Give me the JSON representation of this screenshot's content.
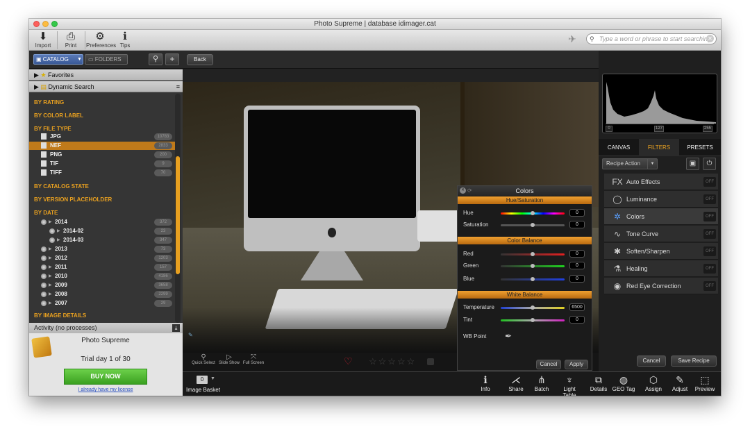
{
  "window": {
    "title": "Photo Supreme | database idimager.cat"
  },
  "toolbar": {
    "import": "Import",
    "print": "Print",
    "preferences": "Preferences",
    "tips": "Tips",
    "search_placeholder": "Type a word or phrase to start searching"
  },
  "left": {
    "catalog": "CATALOG",
    "folders": "FOLDERS",
    "favorites": "Favorites",
    "dynamic_search": "Dynamic Search",
    "sections": {
      "rating": "BY RATING",
      "color": "BY COLOR LABEL",
      "filetype": "BY FILE TYPE",
      "catalog_state": "BY CATALOG STATE",
      "version": "BY VERSION PLACEHOLDER",
      "date": "BY DATE",
      "image_details": "BY IMAGE DETAILS"
    },
    "file_types": [
      {
        "label": "JPG",
        "count": "10783"
      },
      {
        "label": "NEF",
        "count": "2833"
      },
      {
        "label": "PNG",
        "count": "200"
      },
      {
        "label": "TIF",
        "count": "9"
      },
      {
        "label": "TIFF",
        "count": "70"
      }
    ],
    "dates": [
      {
        "label": "2014",
        "count": "372"
      },
      {
        "label": "2014-02",
        "count": "23"
      },
      {
        "label": "2014-03",
        "count": "347"
      },
      {
        "label": "2013",
        "count": "73"
      },
      {
        "label": "2012",
        "count": "1203"
      },
      {
        "label": "2011",
        "count": "157"
      },
      {
        "label": "2010",
        "count": "4186"
      },
      {
        "label": "2009",
        "count": "3658"
      },
      {
        "label": "2008",
        "count": "2299"
      },
      {
        "label": "2007",
        "count": "29"
      }
    ],
    "activity": "Activity (no processes)",
    "promo": {
      "app": "Photo Supreme",
      "trial": "Trial day 1 of 30",
      "buy": "BUY NOW",
      "license": "I already have my license"
    }
  },
  "content": {
    "back": "Back",
    "quick_select": "Quick Select",
    "slide_show": "Slide Show",
    "full_screen": "Full Screen"
  },
  "dialog": {
    "title": "Colors",
    "sections": {
      "hs": "Hue/Saturation",
      "cb": "Color Balance",
      "wb": "White Balance"
    },
    "hue": {
      "label": "Hue",
      "value": "0"
    },
    "saturation": {
      "label": "Saturation",
      "value": "0"
    },
    "red": {
      "label": "Red",
      "value": "0"
    },
    "green": {
      "label": "Green",
      "value": "0"
    },
    "blue": {
      "label": "Blue",
      "value": "0"
    },
    "temperature": {
      "label": "Temperature",
      "value": "6500"
    },
    "tint": {
      "label": "Tint",
      "value": "0"
    },
    "wb_point": "WB Point",
    "cancel": "Cancel",
    "apply": "Apply"
  },
  "right": {
    "hist_labels": [
      "0",
      "127",
      "255"
    ],
    "tabs": [
      "CANVAS",
      "FILTERS",
      "PRESETS"
    ],
    "recipe": "Recipe Action",
    "filters": [
      {
        "label": "Auto Effects",
        "icon": "FX"
      },
      {
        "label": "Luminance",
        "icon": "◯"
      },
      {
        "label": "Colors",
        "icon": "✲"
      },
      {
        "label": "Tone Curve",
        "icon": "∿"
      },
      {
        "label": "Soften/Sharpen",
        "icon": "✱"
      },
      {
        "label": "Healing",
        "icon": "⚗"
      },
      {
        "label": "Red Eye Correction",
        "icon": "◉"
      }
    ],
    "off": "OFF",
    "cancel": "Cancel",
    "save_recipe": "Save Recipe"
  },
  "bottom": {
    "basket_count": "0",
    "basket": "Image Basket",
    "buttons": [
      "Info",
      "Share",
      "Batch",
      "Light Table",
      "Details",
      "GEO Tag",
      "Assign",
      "Adjust",
      "Preview"
    ]
  },
  "colors": {
    "accent": "#e8a020",
    "buy": "#4ab02a"
  }
}
